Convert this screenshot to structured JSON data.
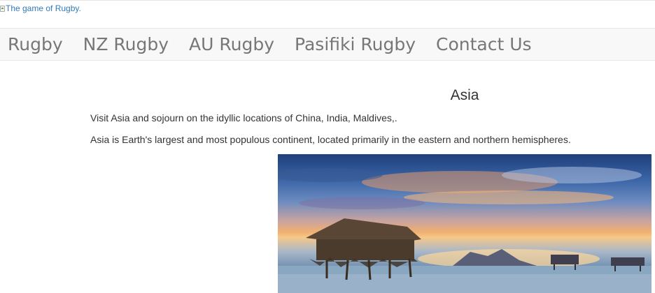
{
  "logo": {
    "alt_text": "The game of Rugby."
  },
  "nav": {
    "items": [
      {
        "label": "Rugby"
      },
      {
        "label": "NZ Rugby"
      },
      {
        "label": "AU Rugby"
      },
      {
        "label": "Pasifiki Rugby"
      },
      {
        "label": "Contact Us"
      }
    ]
  },
  "content": {
    "title": "Asia",
    "intro": "Visit Asia and sojourn on the idyllic locations of China, India, Maldives,.",
    "description": "Asia is Earth's largest and most populous continent, located primarily in the eastern and northern hemispheres."
  },
  "colors": {
    "nav_background": "#f8f8f8",
    "nav_text": "#777777",
    "link": "#337ab7",
    "body_text": "#333333"
  },
  "photo": {
    "subject": "stilt houses over water at sunset"
  }
}
